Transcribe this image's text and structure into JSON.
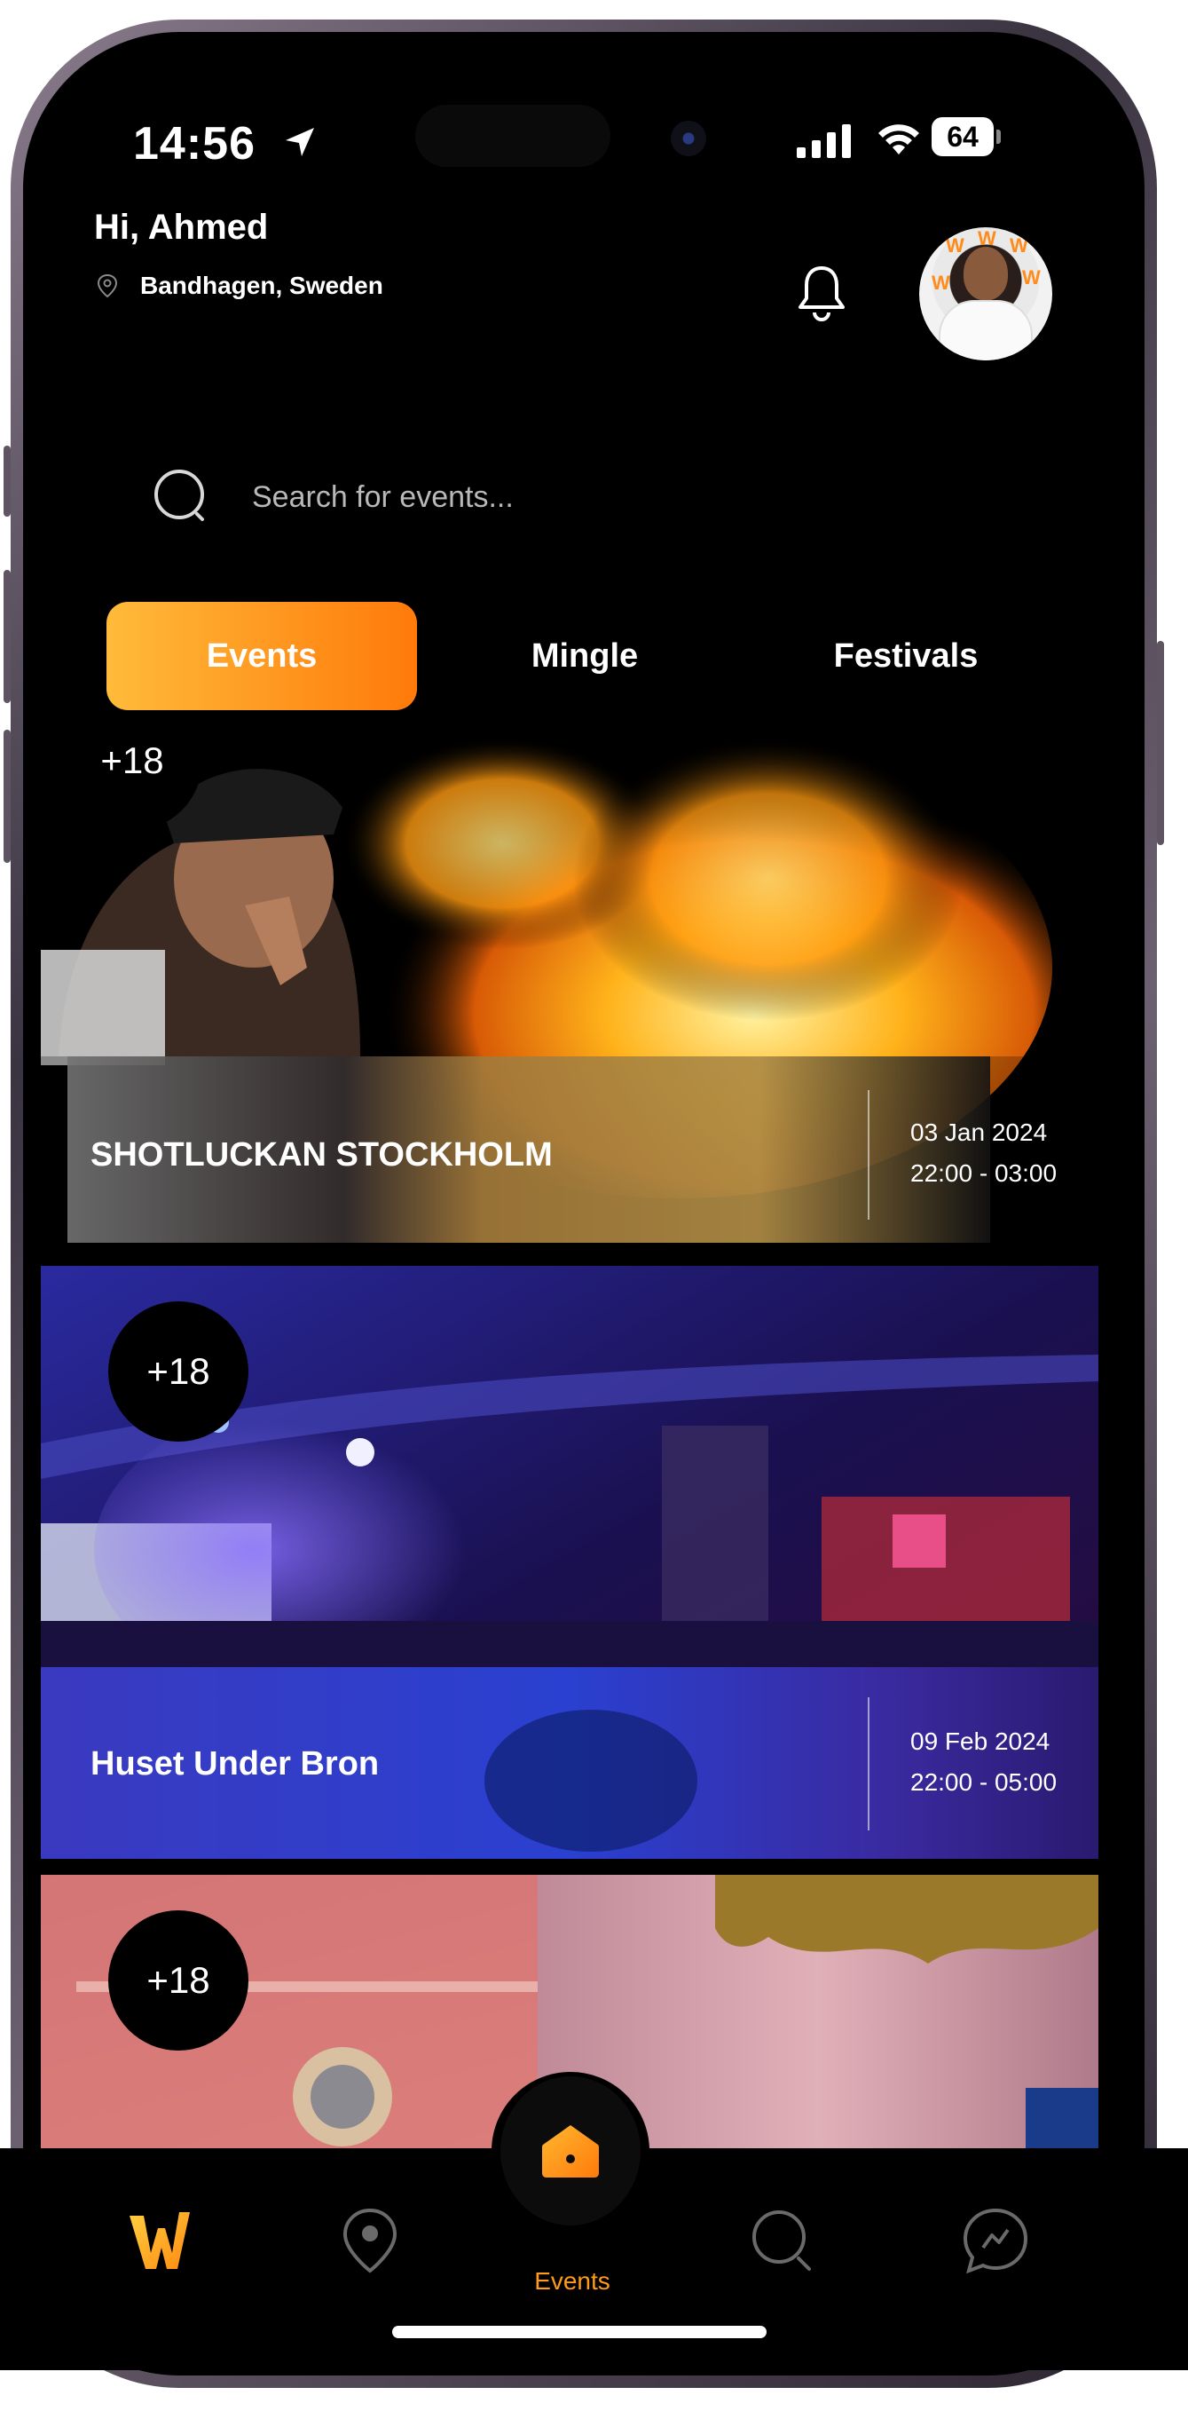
{
  "status_bar": {
    "time": "14:56",
    "battery": "64"
  },
  "header": {
    "greeting": "Hi, Ahmed",
    "location": "Bandhagen, Sweden",
    "icons": {
      "location": "location-pin-icon",
      "notifications": "bell-icon",
      "avatar": "user-avatar"
    }
  },
  "search": {
    "placeholder": "Search for events...",
    "icon": "search-icon"
  },
  "tabs": [
    {
      "label": "Events",
      "active": true
    },
    {
      "label": "Mingle",
      "active": false
    },
    {
      "label": "Festivals",
      "active": false
    }
  ],
  "events": [
    {
      "age_limit": "+18",
      "title": "SHOTLUCKAN STOCKHOLM",
      "date": "03 Jan 2024",
      "hours": "22:00 - 03:00"
    },
    {
      "age_limit": "+18",
      "title": "Huset Under Bron",
      "date": "09 Feb 2024",
      "hours": "22:00 - 05:00"
    },
    {
      "age_limit": "+18",
      "title": "",
      "date": "",
      "hours": ""
    }
  ],
  "bottom_nav": {
    "active_label": "Events",
    "items": [
      "logo-w-icon",
      "map-pin-icon",
      "home-icon",
      "search-icon",
      "chat-icon"
    ]
  },
  "colors": {
    "accent_start": "#ffbb3a",
    "accent_end": "#ff7a0a",
    "background": "#000000"
  }
}
